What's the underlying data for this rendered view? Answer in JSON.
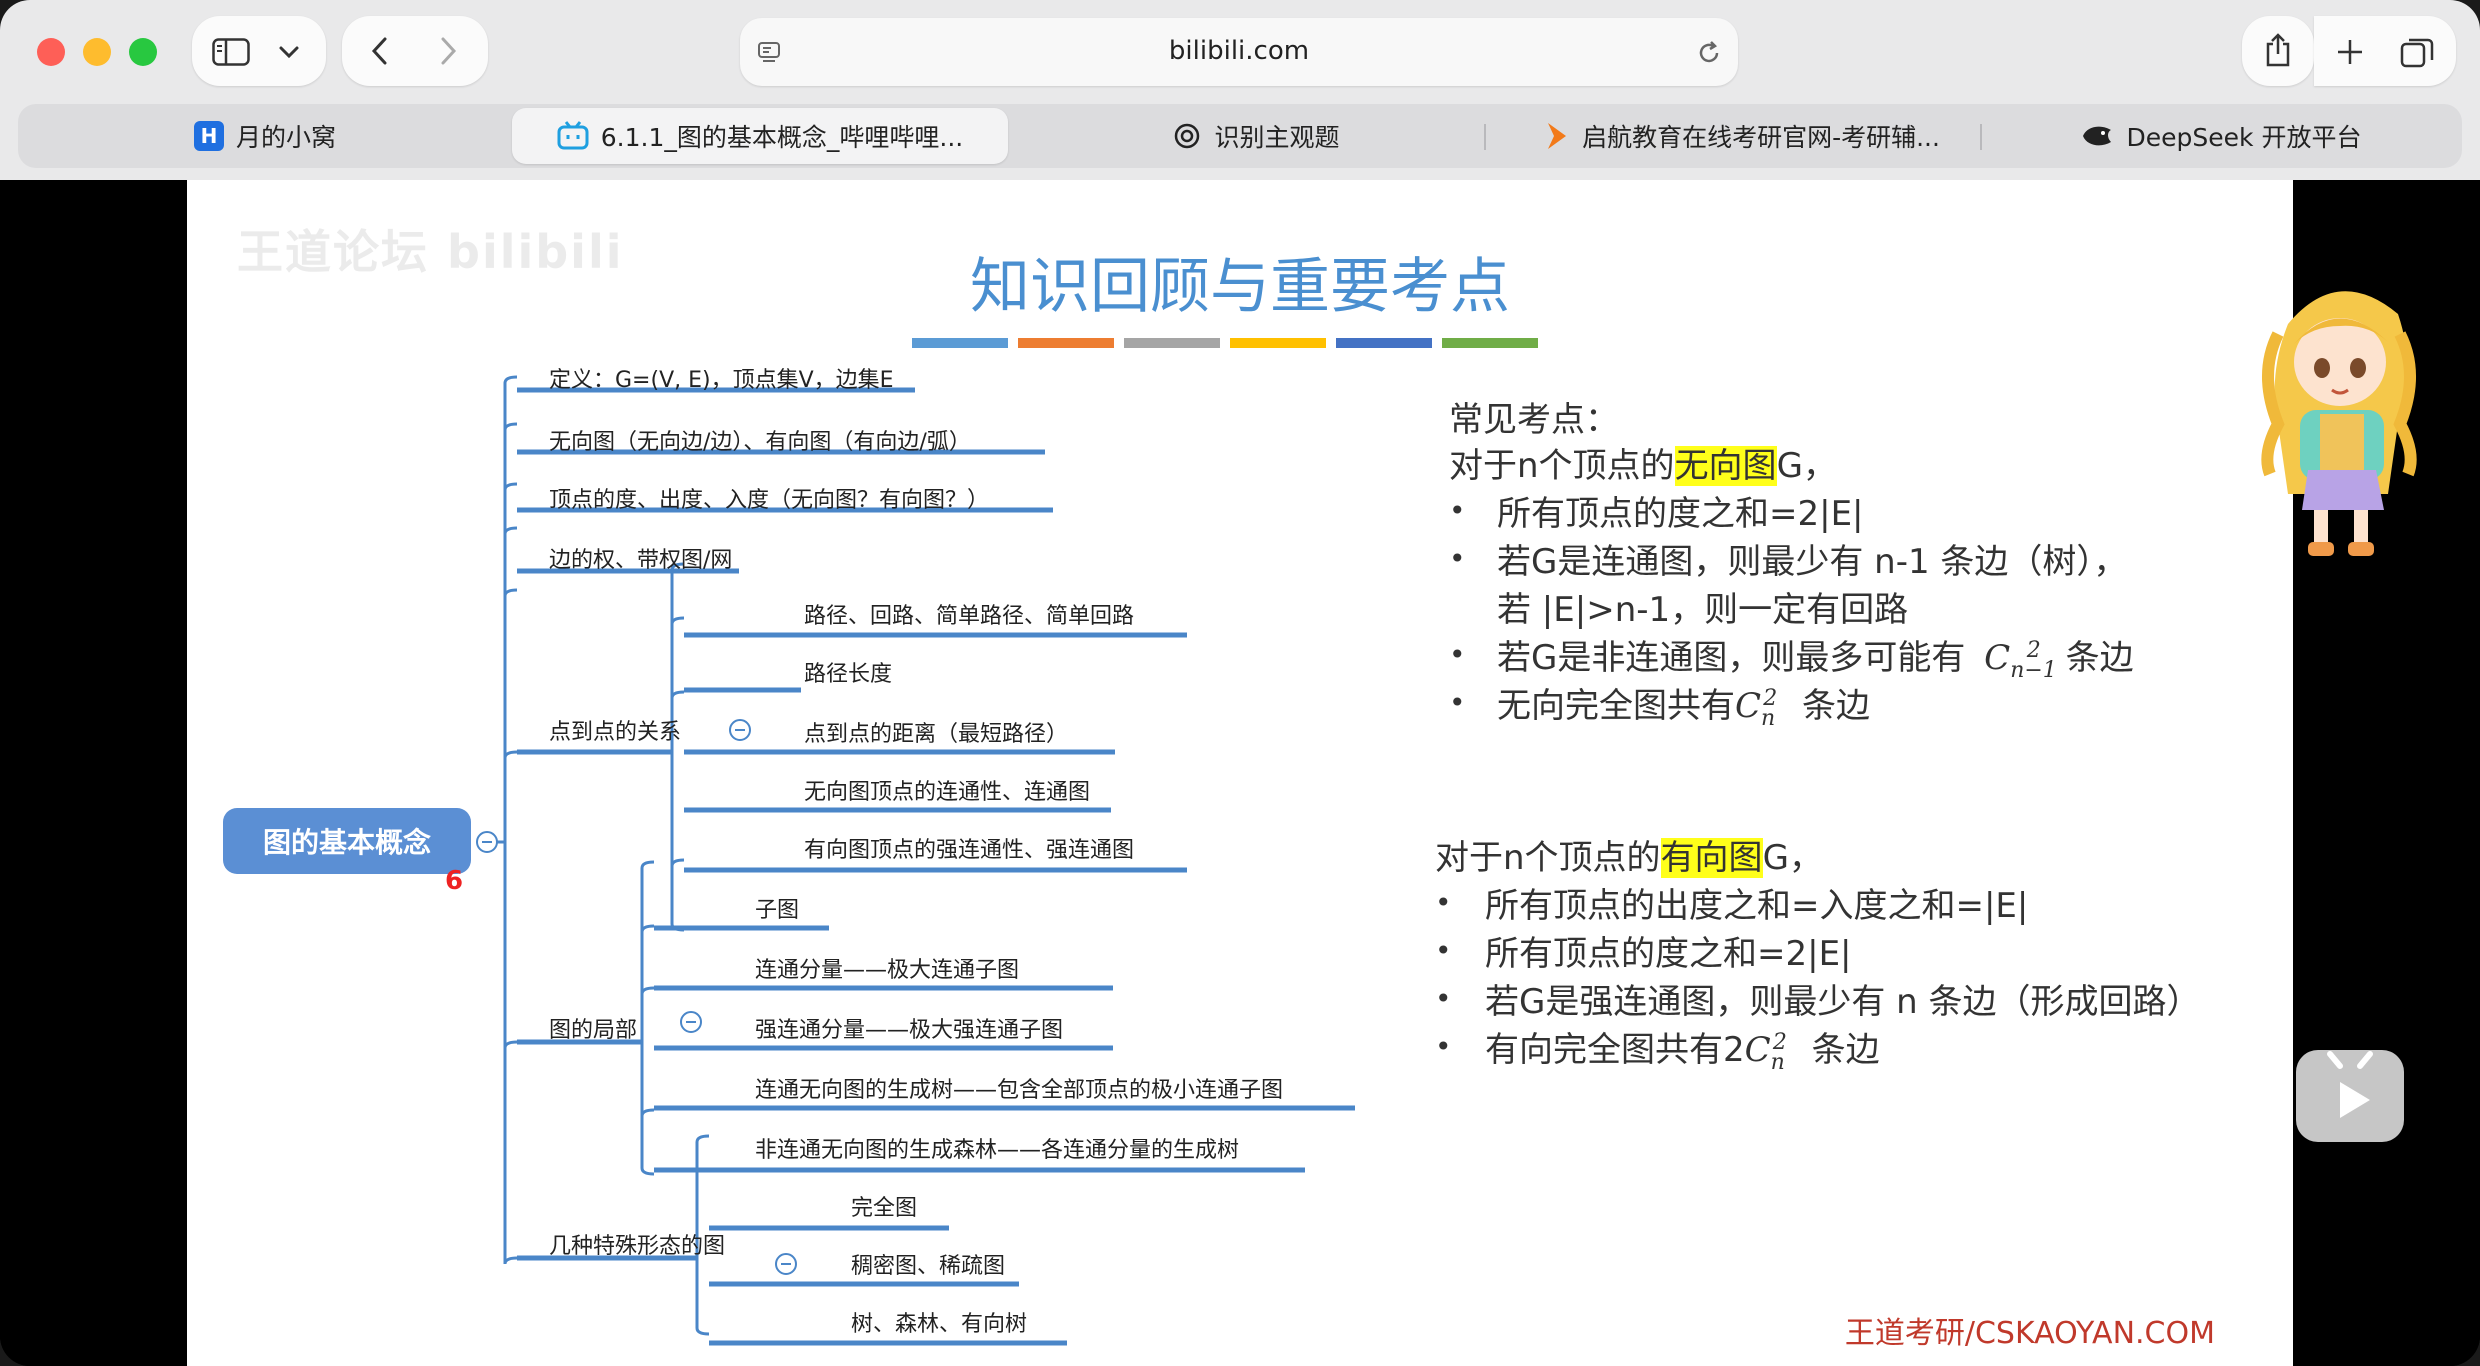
{
  "browser": {
    "url": "bilibili.com",
    "tabs": [
      {
        "title": "月的小窝",
        "favicon": "H"
      },
      {
        "title": "6.1.1_图的基本概念_哔哩哔哩...",
        "favicon": "bilibili-icon"
      },
      {
        "title": "识别主观题",
        "favicon": "openai-icon"
      },
      {
        "title": "启航教育在线考研官网-考研辅...",
        "favicon": "qihang-icon"
      },
      {
        "title": "DeepSeek 开放平台",
        "favicon": "deepseek-icon"
      }
    ],
    "active_tab": 1
  },
  "slide": {
    "title": "知识回顾与重要考点",
    "watermark": "王道论坛 bilibili",
    "bar_colors": [
      "#5b9bd5",
      "#ed7d31",
      "#a5a5a5",
      "#ffc000",
      "#4472c4",
      "#70ad47"
    ],
    "footer": "王道考研/CSKAOYAN.COM",
    "mindmap": {
      "root": "图的基本概念",
      "root_note": "6",
      "branches": [
        {
          "label": "定义：G=(V, E)，顶点集V，边集E"
        },
        {
          "label": "无向图（无向边/边）、有向图（有向边/弧）"
        },
        {
          "label": "顶点的度、出度、入度（无向图？有向图？）"
        },
        {
          "label": "边的权、带权图/网"
        },
        {
          "label": "点到点的关系",
          "children": [
            "路径、回路、简单路径、简单回路",
            "路径长度",
            "点到点的距离（最短路径）",
            "无向图顶点的连通性、连通图",
            "有向图顶点的强连通性、强连通图"
          ]
        },
        {
          "label": "图的局部",
          "children": [
            "子图",
            "连通分量——极大连通子图",
            "强连通分量——极大强连通子图",
            "连通无向图的生成树——包含全部顶点的极小连通子图",
            "非连通无向图的生成森林——各连通分量的生成树"
          ]
        },
        {
          "label": "几种特殊形态的图",
          "children": [
            "完全图",
            "稠密图、稀疏图",
            "树、森林、有向树"
          ]
        }
      ]
    },
    "points": {
      "heading": "常见考点：",
      "undirected": {
        "intro_pre": "对于n个顶点的",
        "intro_hl": "无向图",
        "intro_post": "G，",
        "items": [
          "所有顶点的度之和=2|E|",
          "若G是连通图，则最少有 n-1 条边（树），",
          "若G是非连通图，则最多可能有",
          "无向完全图共有"
        ],
        "item2_line2": "若 |E|>n-1，则一定有回路",
        "item3_suffix": "条边",
        "item4_suffix": "条边"
      },
      "directed": {
        "intro_pre": "对于n个顶点的",
        "intro_hl": "有向图",
        "intro_post": "G，",
        "items": [
          "所有顶点的出度之和=入度之和=|E|",
          "所有顶点的度之和=2|E|",
          "若G是强连通图，则最少有 n 条边（形成回路）",
          "有向完全图共有2"
        ],
        "item4_suffix": "条边"
      }
    }
  }
}
